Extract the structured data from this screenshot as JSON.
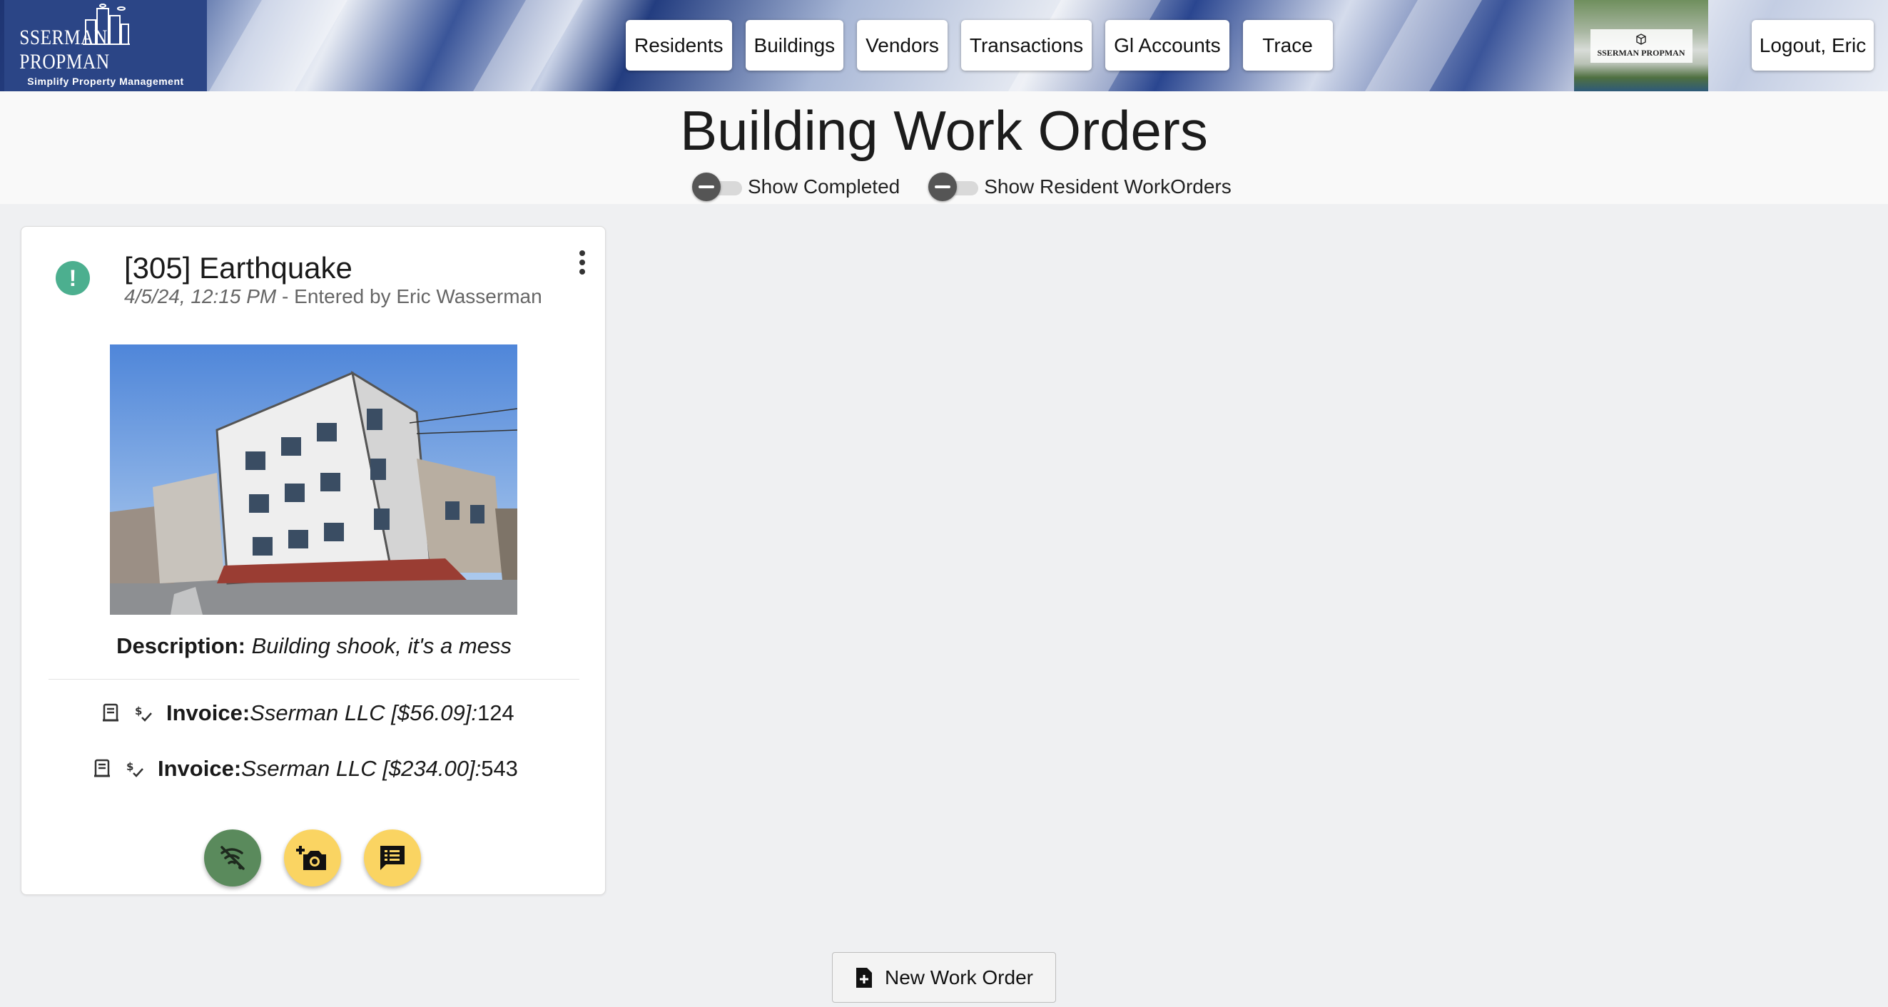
{
  "header": {
    "logo": {
      "name": "SSERMAN PROPMAN",
      "tagline": "Simplify Property Management"
    },
    "nav": [
      {
        "id": "residents",
        "label": "Residents"
      },
      {
        "id": "buildings",
        "label": "Buildings"
      },
      {
        "id": "vendors",
        "label": "Vendors"
      },
      {
        "id": "transactions",
        "label": "Transactions"
      },
      {
        "id": "gl-accounts",
        "label": "Gl Accounts"
      },
      {
        "id": "trace",
        "label": "Trace"
      }
    ],
    "photo_caption": "SSERMAN PROPMAN",
    "logout_label": "Logout, Eric"
  },
  "page": {
    "title": "Building Work Orders",
    "toggles": [
      {
        "label": "Show Completed",
        "on": false
      },
      {
        "label": "Show Resident WorkOrders",
        "on": false
      }
    ]
  },
  "work_order": {
    "title": "[305] Earthquake",
    "date": "4/5/24, 12:15 PM",
    "entered_by": " - Entered by Eric Wasserman",
    "description_label": "Description:",
    "description": "Building shook, it's a mess",
    "invoices": [
      {
        "label": "Invoice:",
        "vendor": "Sserman LLC [$56.09]:",
        "number": " 124"
      },
      {
        "label": "Invoice:",
        "vendor": "Sserman LLC [$234.00]:",
        "number": " 543"
      }
    ],
    "icons": {
      "status": "alert-icon",
      "menu": "more-vertical-icon",
      "actions": [
        "wifi-off-icon",
        "add-photo-icon",
        "notes-icon"
      ]
    },
    "colors": {
      "status": "#4caf8f",
      "action_green": "#5a8a5c",
      "action_yellow": "#fad462"
    }
  },
  "footer": {
    "new_work_order_label": "New Work Order"
  }
}
